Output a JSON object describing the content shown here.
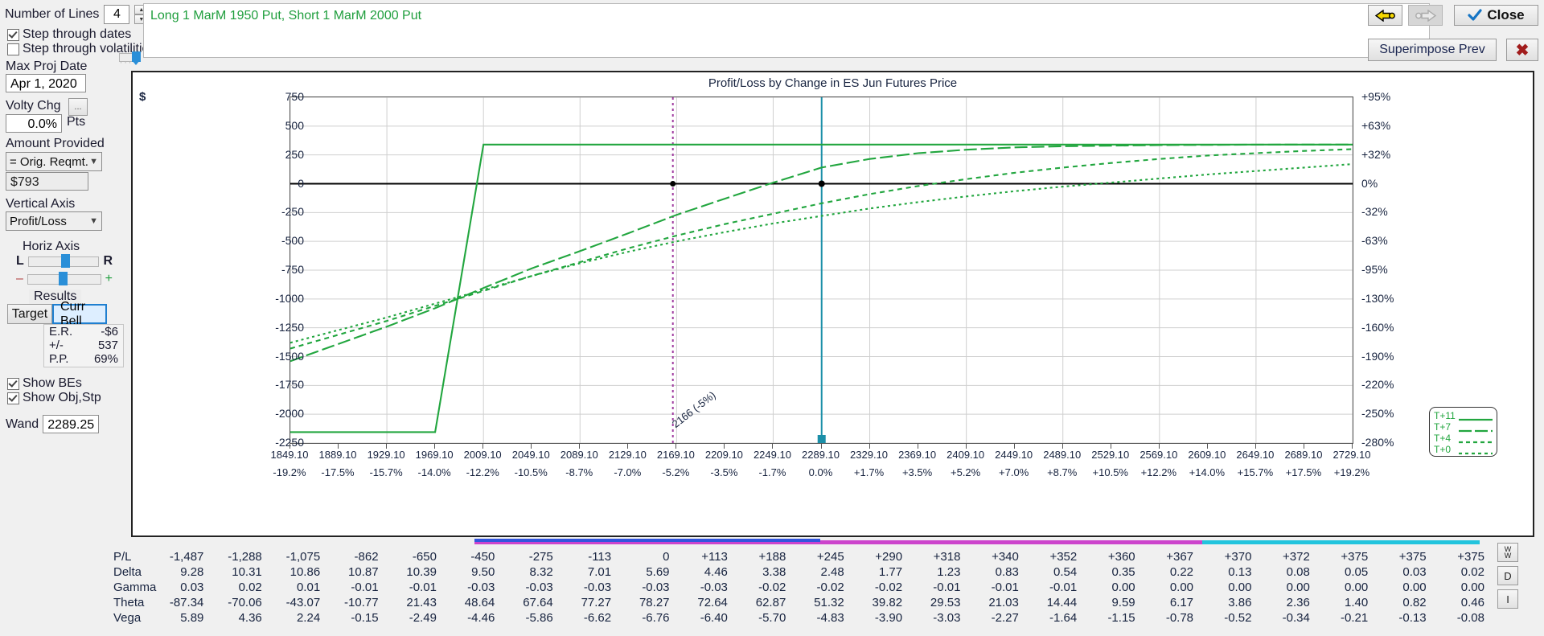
{
  "controls": {
    "number_of_lines_label": "Number of Lines",
    "number_of_lines_value": "4",
    "step_through_dates_label": "Step through dates",
    "step_through_volatilities_label": "Step through volatilities",
    "max_proj_date_label": "Max Proj Date",
    "max_proj_date_value": "Apr 1, 2020",
    "volty_chg_label": "Volty Chg",
    "volty_ellipsis": "...",
    "volty_chg_value": "0.0%",
    "pts_label": "Pts",
    "amount_provided_label": "Amount Provided",
    "amount_provided_value": "= Orig. Reqmt.",
    "amount_value": "$793",
    "vertical_axis_label": "Vertical Axis",
    "vertical_axis_value": "Profit/Loss",
    "horiz_axis_label": "Horiz Axis",
    "horiz_left_label": "L",
    "horiz_right_label": "R",
    "zoom_minus_label": "–",
    "zoom_plus_label": "+",
    "results_label": "Results",
    "target_label": "Target",
    "curr_bell_label": "Curr Bell",
    "er_label": "E.R.",
    "er_value": "-$6",
    "plusminus_label": "+/-",
    "plusminus_value": "537",
    "pp_label": "P.P.",
    "pp_value": "69%",
    "show_bes_label": "Show BEs",
    "show_objstp_label": "Show Obj,Stp",
    "wand_label": "Wand",
    "wand_value": "2289.25"
  },
  "strategy": {
    "text": "Long 1 MarM 1950 Put, Short 1 MarM 2000 Put"
  },
  "toolbar": {
    "back_label": "",
    "forward_label": "",
    "close_label": "Close",
    "superimpose_label": "Superimpose Prev",
    "delete_label": "✖"
  },
  "chart_data": {
    "type": "line",
    "title": "Profit/Loss by Change in ES Jun Futures Price",
    "ylabel": "$",
    "xlabel": "",
    "ylim": [
      -2250,
      750
    ],
    "yticks": [
      750,
      500,
      250,
      0,
      -250,
      -500,
      -750,
      -1000,
      -1250,
      -1500,
      -1750,
      -2000,
      -2250
    ],
    "y2ticks": [
      "+95%",
      "+63%",
      "+32%",
      "0%",
      "-32%",
      "-63%",
      "-95%",
      "-130%",
      "-160%",
      "-190%",
      "-220%",
      "-250%",
      "-280%"
    ],
    "categories": [
      "1849.10",
      "1889.10",
      "1929.10",
      "1969.10",
      "2009.10",
      "2049.10",
      "2089.10",
      "2129.10",
      "2169.10",
      "2209.10",
      "2249.10",
      "2289.10",
      "2329.10",
      "2369.10",
      "2409.10",
      "2449.10",
      "2489.10",
      "2529.10",
      "2569.10",
      "2609.10",
      "2649.10",
      "2689.10",
      "2729.10"
    ],
    "category_pct": [
      "-19.2%",
      "-17.5%",
      "-15.7%",
      "-14.0%",
      "-12.2%",
      "-10.5%",
      "-8.7%",
      "-7.0%",
      "-5.2%",
      "-3.5%",
      "-1.7%",
      "0.0%",
      "+1.7%",
      "+3.5%",
      "+5.2%",
      "+7.0%",
      "+8.7%",
      "+10.5%",
      "+12.2%",
      "+14.0%",
      "+15.7%",
      "+17.5%",
      "+19.2%"
    ],
    "legend": [
      {
        "name": "T+11",
        "style": "solid"
      },
      {
        "name": "T+7",
        "style": "longdash"
      },
      {
        "name": "T+4",
        "style": "dash"
      },
      {
        "name": "T+0",
        "style": "dot"
      }
    ],
    "legend_position": "bottom-right",
    "grid": true,
    "annotations": [
      {
        "text": "2166 (-5%)",
        "x": 2166,
        "type": "breakeven-line",
        "color": "#a03ca0"
      },
      {
        "text": "",
        "x": 2289.25,
        "type": "current-price-line",
        "color": "#1b8fa8"
      }
    ],
    "series": [
      {
        "name": "T+11",
        "style": "solid",
        "values": [
          -2155,
          -2155,
          -2155,
          -2155,
          340,
          340,
          340,
          340,
          340,
          340,
          340,
          340,
          340,
          340,
          340,
          340,
          340,
          340,
          340,
          340,
          340,
          340,
          340
        ]
      },
      {
        "name": "T+7",
        "style": "longdash",
        "values": [
          -1540,
          -1390,
          -1240,
          -1080,
          -905,
          -735,
          -585,
          -430,
          -270,
          -130,
          10,
          140,
          215,
          265,
          295,
          315,
          325,
          330,
          335,
          337,
          339,
          340,
          340
        ]
      },
      {
        "name": "T+4",
        "style": "dash",
        "values": [
          -1430,
          -1310,
          -1190,
          -1060,
          -930,
          -800,
          -680,
          -560,
          -450,
          -350,
          -260,
          -170,
          -90,
          -20,
          40,
          95,
          140,
          180,
          215,
          245,
          265,
          285,
          300
        ]
      },
      {
        "name": "T+0",
        "style": "dot",
        "values": [
          -1380,
          -1270,
          -1160,
          -1040,
          -920,
          -800,
          -690,
          -590,
          -500,
          -420,
          -345,
          -280,
          -215,
          -160,
          -110,
          -65,
          -25,
          10,
          45,
          80,
          110,
          140,
          170
        ]
      }
    ]
  },
  "table": {
    "rows": [
      {
        "label": "P/L",
        "values": [
          "-1,487",
          "-1,288",
          "-1,075",
          "-862",
          "-650",
          "-450",
          "-275",
          "-113",
          "0",
          "+113",
          "+188",
          "+245",
          "+290",
          "+318",
          "+340",
          "+352",
          "+360",
          "+367",
          "+370",
          "+372",
          "+375",
          "+375",
          "+375"
        ]
      },
      {
        "label": "Delta",
        "values": [
          "9.28",
          "10.31",
          "10.86",
          "10.87",
          "10.39",
          "9.50",
          "8.32",
          "7.01",
          "5.69",
          "4.46",
          "3.38",
          "2.48",
          "1.77",
          "1.23",
          "0.83",
          "0.54",
          "0.35",
          "0.22",
          "0.13",
          "0.08",
          "0.05",
          "0.03",
          "0.02"
        ]
      },
      {
        "label": "Gamma",
        "values": [
          "0.03",
          "0.02",
          "0.01",
          "-0.01",
          "-0.01",
          "-0.03",
          "-0.03",
          "-0.03",
          "-0.03",
          "-0.03",
          "-0.02",
          "-0.02",
          "-0.02",
          "-0.01",
          "-0.01",
          "-0.01",
          "0.00",
          "0.00",
          "0.00",
          "0.00",
          "0.00",
          "0.00",
          "0.00"
        ]
      },
      {
        "label": "Theta",
        "values": [
          "-87.34",
          "-70.06",
          "-43.07",
          "-10.77",
          "21.43",
          "48.64",
          "67.64",
          "77.27",
          "78.27",
          "72.64",
          "62.87",
          "51.32",
          "39.82",
          "29.53",
          "21.03",
          "14.44",
          "9.59",
          "6.17",
          "3.86",
          "2.36",
          "1.40",
          "0.82",
          "0.46"
        ]
      },
      {
        "label": "Vega",
        "values": [
          "5.89",
          "4.36",
          "2.24",
          "-0.15",
          "-2.49",
          "-4.46",
          "-5.86",
          "-6.62",
          "-6.76",
          "-6.40",
          "-5.70",
          "-4.83",
          "-3.90",
          "-3.03",
          "-2.27",
          "-1.64",
          "-1.15",
          "-0.78",
          "-0.52",
          "-0.34",
          "-0.21",
          "-0.13",
          "-0.08"
        ]
      }
    ],
    "side_buttons": [
      "W",
      "D",
      "I"
    ]
  },
  "colors": {
    "series_green": "#22a63f",
    "breakeven_purple": "#a03ca0",
    "current_teal": "#1b8fa8",
    "range_magenta": "#cc44cc",
    "range_blue": "#3355dd",
    "range_cyan": "#22c4dd"
  }
}
